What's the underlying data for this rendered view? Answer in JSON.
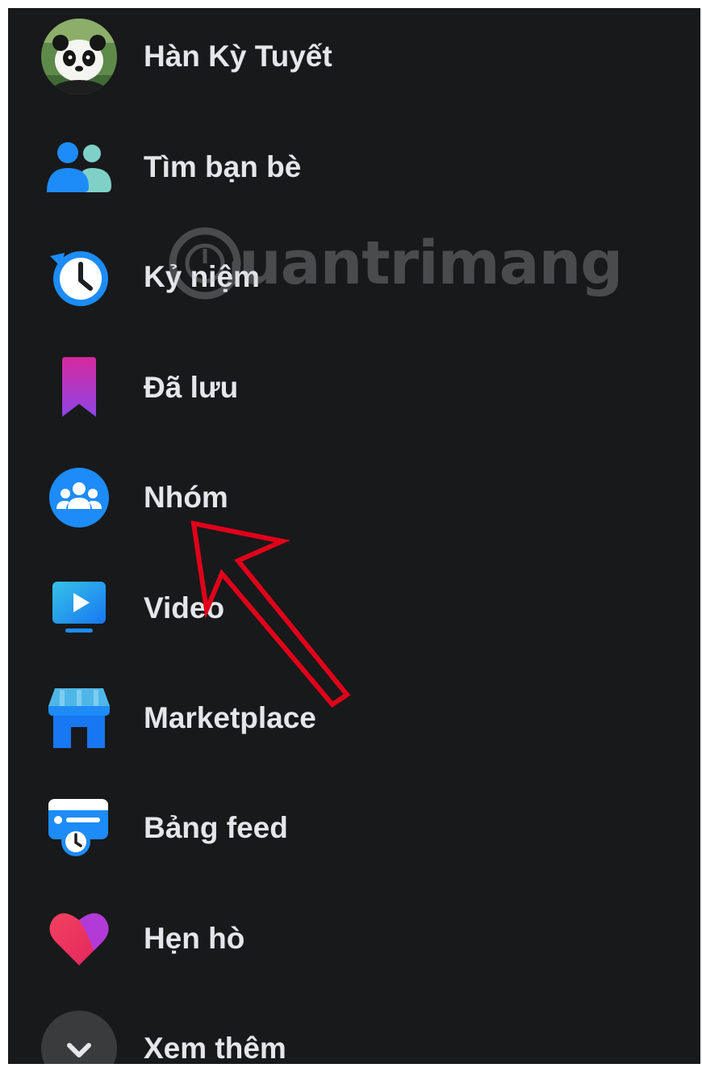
{
  "menu": {
    "items": [
      {
        "label": "Hàn Kỳ Tuyết",
        "icon": "profile-avatar"
      },
      {
        "label": "Tìm bạn bè",
        "icon": "friends-icon"
      },
      {
        "label": "Kỷ niệm",
        "icon": "memories-icon"
      },
      {
        "label": "Đã lưu",
        "icon": "saved-icon"
      },
      {
        "label": "Nhóm",
        "icon": "groups-icon"
      },
      {
        "label": "Video",
        "icon": "video-icon"
      },
      {
        "label": "Marketplace",
        "icon": "marketplace-icon"
      },
      {
        "label": "Bảng feed",
        "icon": "feeds-icon"
      },
      {
        "label": "Hẹn hò",
        "icon": "dating-icon"
      },
      {
        "label": "Xem thêm",
        "icon": "chevron-down-icon"
      }
    ]
  },
  "watermark": {
    "text": "uantrimang"
  },
  "colors": {
    "background": "#18191a",
    "text": "#e4e6eb",
    "accent_blue": "#1877f2",
    "annotation_red": "#e0001a"
  }
}
